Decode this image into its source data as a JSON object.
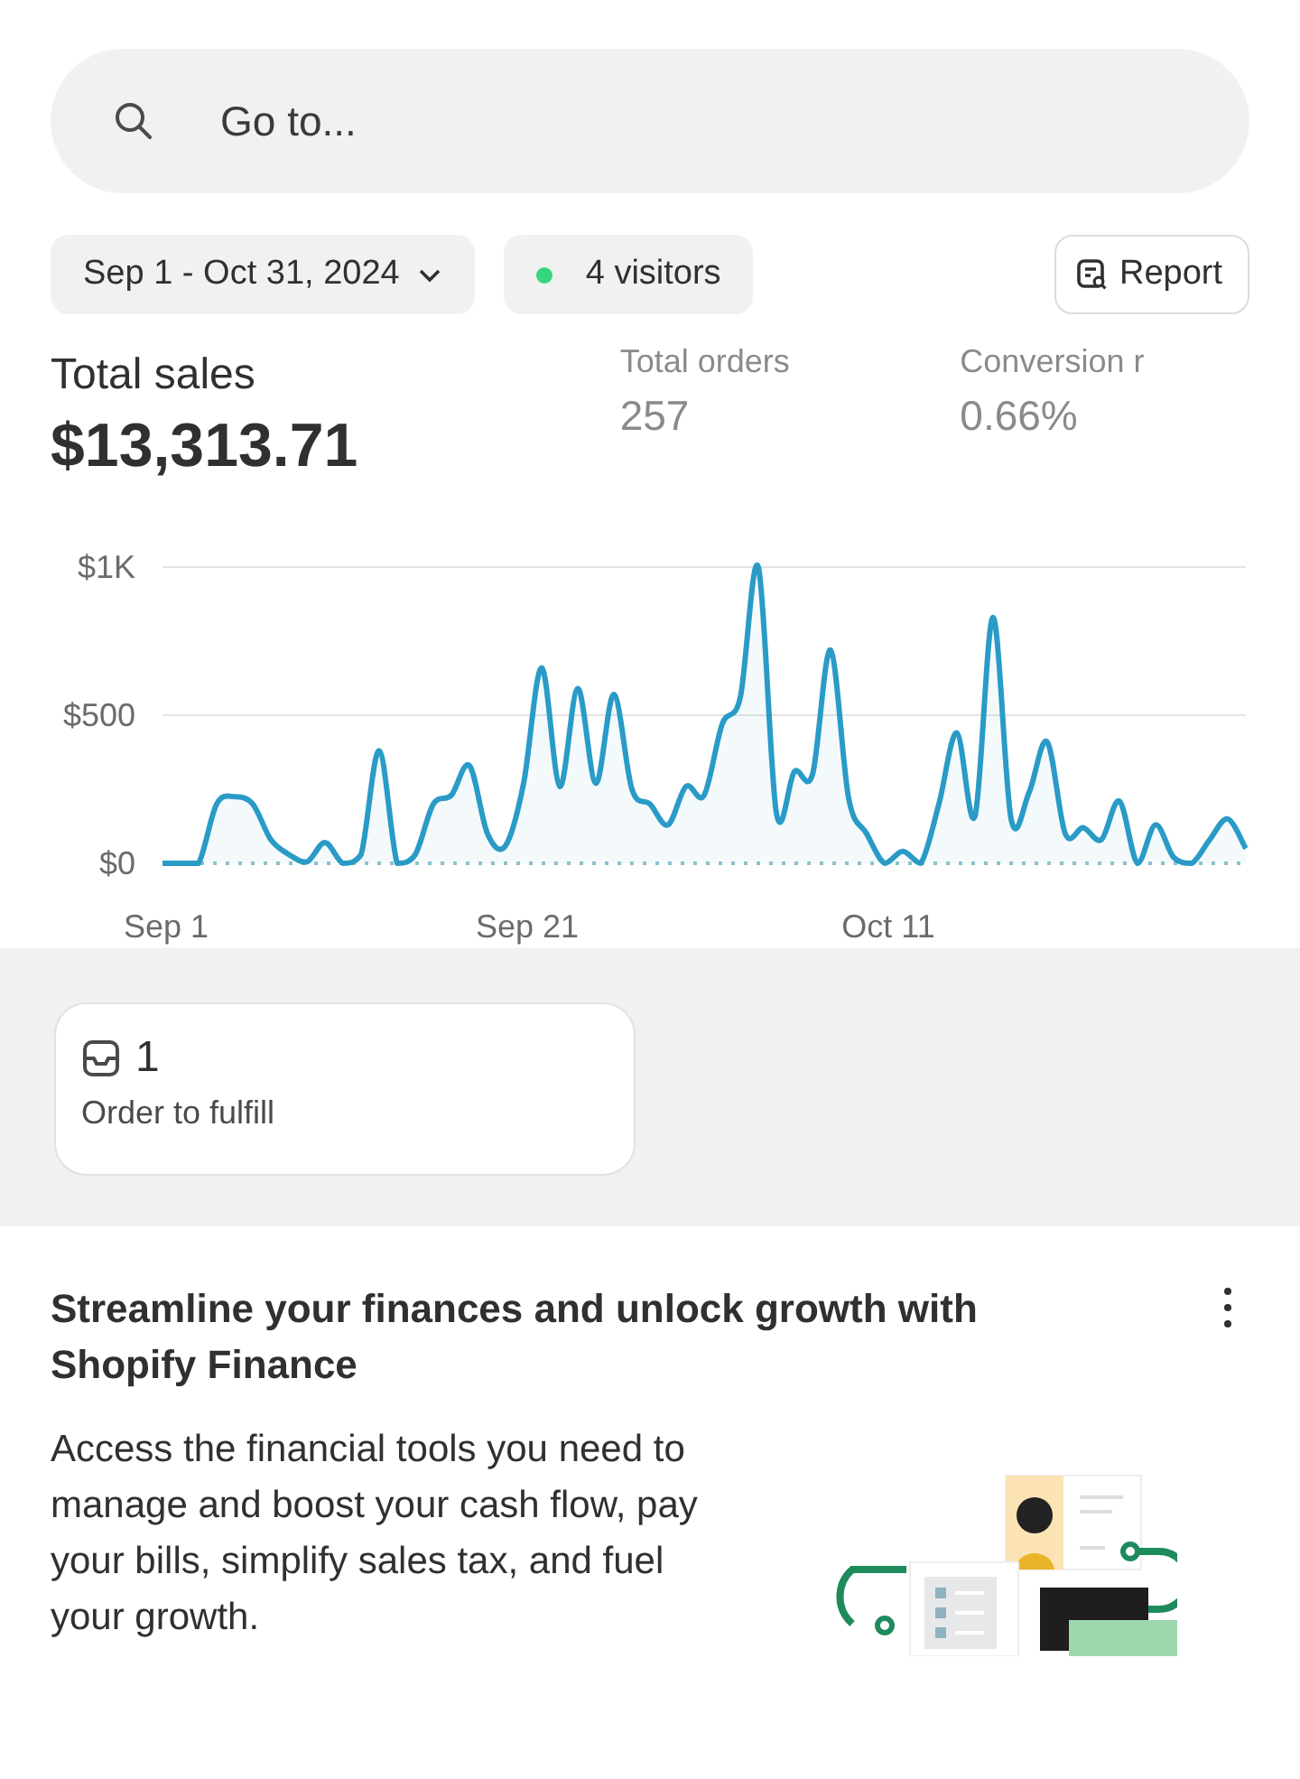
{
  "search": {
    "placeholder": "Go to..."
  },
  "filters": {
    "date_range": "Sep 1 - Oct 31, 2024",
    "visitors": "4 visitors",
    "report_button": "Report"
  },
  "metrics": [
    {
      "label": "Total sales",
      "value": "$13,313.71",
      "kind": "primary"
    },
    {
      "label": "Total orders",
      "value": "257",
      "kind": "secondary"
    },
    {
      "label": "Conversion r",
      "value": "0.66%",
      "kind": "secondary"
    }
  ],
  "chart_data": {
    "type": "line",
    "yticks": [
      {
        "value": 0,
        "label": "$0"
      },
      {
        "value": 500,
        "label": "$500"
      },
      {
        "value": 1000,
        "label": "$1K"
      }
    ],
    "ylim": [
      0,
      1000
    ],
    "categories": [
      "Sep 1",
      null,
      null,
      null,
      null,
      null,
      null,
      null,
      null,
      null,
      null,
      null,
      null,
      null,
      null,
      null,
      null,
      null,
      null,
      null,
      "Sep 21",
      null,
      null,
      null,
      null,
      null,
      null,
      null,
      null,
      null,
      null,
      null,
      null,
      null,
      null,
      null,
      null,
      null,
      null,
      null,
      "Oct 11",
      null,
      null,
      null,
      null,
      null,
      null,
      null,
      null,
      null,
      null,
      null,
      null,
      null,
      null,
      null,
      null,
      null,
      null,
      null,
      null
    ],
    "series": [
      {
        "color": "#2a9bc7",
        "values": [
          0,
          0,
          0,
          200,
          225,
          200,
          80,
          30,
          5,
          70,
          0,
          30,
          380,
          0,
          30,
          200,
          230,
          330,
          100,
          60,
          270,
          660,
          260,
          590,
          270,
          570,
          250,
          200,
          130,
          260,
          230,
          470,
          560,
          1000,
          170,
          310,
          300,
          720,
          220,
          100,
          0,
          40,
          0,
          200,
          440,
          160,
          830,
          150,
          240,
          410,
          100,
          120,
          80,
          210,
          0,
          130,
          20,
          0,
          80,
          150,
          50
        ]
      }
    ]
  },
  "tasks": [
    {
      "count": "1",
      "label": "Order to fulfill"
    }
  ],
  "promo": {
    "title": "Streamline your finances and unlock growth with Shopify Finance",
    "body": "Access the financial tools you need to manage and boost your cash flow, pay your bills, simplify sales tax, and fuel your growth."
  }
}
